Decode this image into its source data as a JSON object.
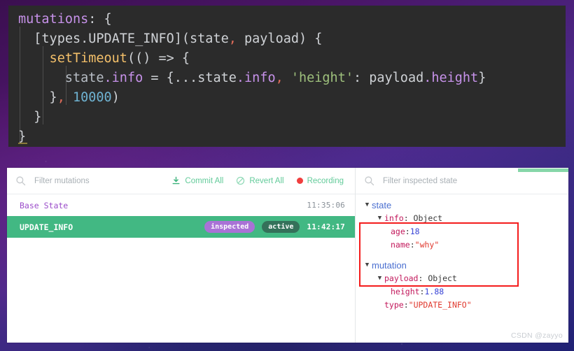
{
  "editor": {
    "lines": [
      [
        {
          "t": "mutations",
          "c": "t-key"
        },
        {
          "t": ": {",
          "c": "t-plain"
        }
      ],
      [
        {
          "t": "  [types.UPDATE_INFO](state",
          "c": "t-plain"
        },
        {
          "t": ",",
          "c": "t-comma"
        },
        {
          "t": " payload) {",
          "c": "t-plain"
        }
      ],
      [
        {
          "t": "    ",
          "c": "t-plain"
        },
        {
          "t": "setTimeout",
          "c": "t-fn"
        },
        {
          "t": "(() => {",
          "c": "t-plain"
        }
      ],
      [
        {
          "t": "      state",
          "c": "t-ident"
        },
        {
          "t": ".info",
          "c": "t-key"
        },
        {
          "t": " = {...state",
          "c": "t-plain"
        },
        {
          "t": ".info",
          "c": "t-key"
        },
        {
          "t": ",",
          "c": "t-comma"
        },
        {
          "t": " 'height'",
          "c": "t-str"
        },
        {
          "t": ": payload",
          "c": "t-plain"
        },
        {
          "t": ".height",
          "c": "t-key"
        },
        {
          "t": "}",
          "c": "t-plain"
        }
      ],
      [
        {
          "t": "    }",
          "c": "t-plain"
        },
        {
          "t": ",",
          "c": "t-comma"
        },
        {
          "t": " ",
          "c": "t-plain"
        },
        {
          "t": "10000",
          "c": "t-num"
        },
        {
          "t": ")",
          "c": "t-plain"
        }
      ],
      [
        {
          "t": "  }",
          "c": "t-plain"
        }
      ],
      [
        {
          "t": "}",
          "c": "t-plain"
        }
      ]
    ]
  },
  "devtools": {
    "mutations_pane": {
      "search_placeholder": "Filter mutations",
      "search_value": "",
      "actions": [
        {
          "id": "commit-all",
          "label": "Commit All",
          "icon": "download-icon"
        },
        {
          "id": "revert-all",
          "label": "Revert All",
          "icon": "revert-icon"
        },
        {
          "id": "recording",
          "label": "Recording",
          "icon": "record-dot-icon"
        }
      ],
      "rows": [
        {
          "name": "Base State",
          "time": "11:35:06",
          "badges": [],
          "selected": false
        },
        {
          "name": "UPDATE_INFO",
          "time": "11:42:17",
          "badges": [
            "inspected",
            "active"
          ],
          "selected": true
        }
      ]
    },
    "inspector_pane": {
      "search_placeholder": "Filter inspected state",
      "search_value": "",
      "sections": [
        {
          "root": "state",
          "children": [
            {
              "key": "info",
              "type": "Object",
              "expandable": true,
              "props": [
                {
                  "key": "age",
                  "value": "18",
                  "kind": "number"
                },
                {
                  "key": "name",
                  "value": "\"why\"",
                  "kind": "string"
                }
              ]
            }
          ]
        },
        {
          "root": "mutation",
          "children": [
            {
              "key": "payload",
              "type": "Object",
              "expandable": true,
              "props": [
                {
                  "key": "height",
                  "value": "1.88",
                  "kind": "number"
                }
              ]
            },
            {
              "key": "type",
              "value": "\"UPDATE_INFO\"",
              "kind": "string",
              "expandable": false
            }
          ]
        }
      ]
    },
    "watermark": "CSDN @zayyo",
    "colors": {
      "accent_green": "#42b883",
      "tab_accent": "#86d6a9",
      "badge_inspected": "#a972d6",
      "badge_active": "#34715a",
      "highlight_box": "#f41c1c",
      "record_red": "#f03e3e"
    }
  }
}
